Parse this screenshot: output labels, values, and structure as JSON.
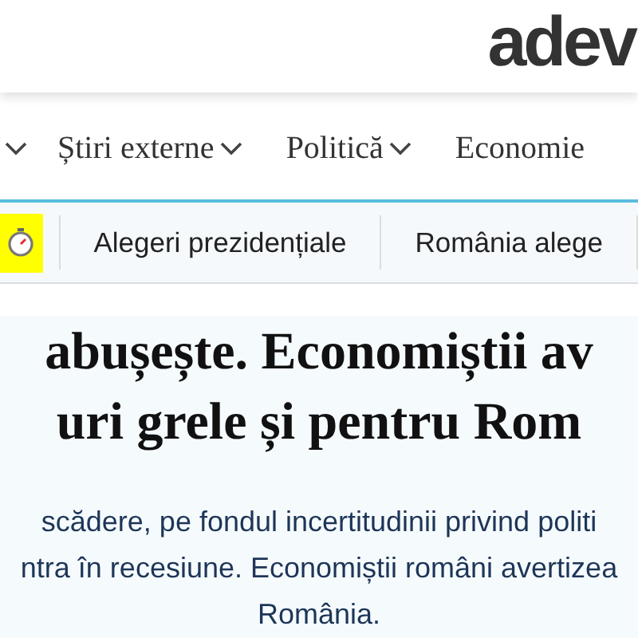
{
  "logo": "adev",
  "nav": {
    "leading_chevron": true,
    "items": [
      {
        "label": "Știri externe",
        "has_menu": true
      },
      {
        "label": "Politică",
        "has_menu": true
      },
      {
        "label": "Economie",
        "has_menu": false
      }
    ]
  },
  "strip": {
    "live_highlighted": true,
    "topics": [
      "Alegeri prezidențiale",
      "România alege"
    ]
  },
  "article": {
    "headline_lines": [
      "abușește. Economiștii av",
      "uri grele și pentru Rom"
    ],
    "summary_lines": [
      "scădere, pe fondul incertitudinii privind politi",
      "ntra în recesiune. Economiștii români avertizea",
      "România."
    ]
  }
}
